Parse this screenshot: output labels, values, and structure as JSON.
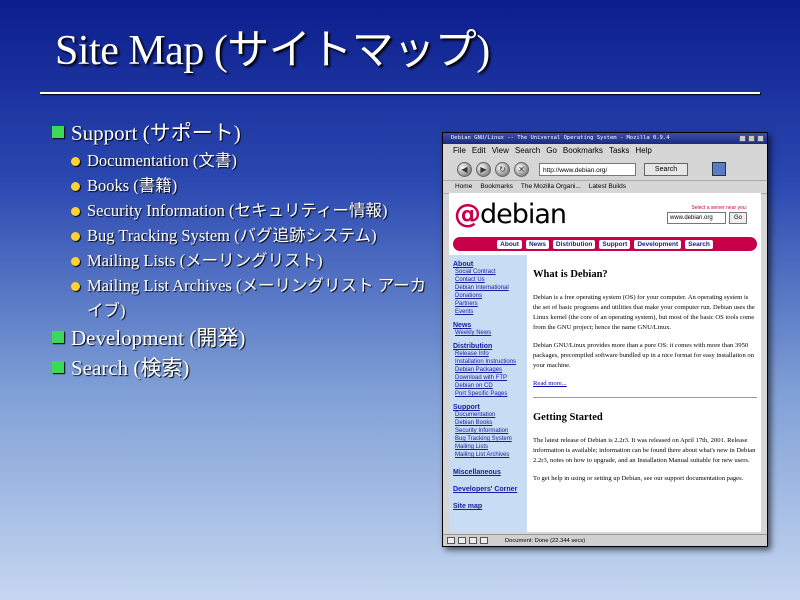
{
  "slide": {
    "title": "Site Map (サイトマップ)",
    "outline": [
      {
        "label": "Support (サポート)",
        "children": [
          "Documentation (文書)",
          "Books (書籍)",
          "Security Information (セキュリティー情報)",
          "Bug Tracking System (バグ追跡システム)",
          "Mailing Lists (メーリングリスト)",
          "Mailing List Archives (メーリングリスト アーカイブ)"
        ]
      },
      {
        "label": "Development (開発)"
      },
      {
        "label": "Search (検索)"
      }
    ]
  },
  "browser": {
    "window_title": "Debian GNU/Linux -- The Universal Operating System - Mozilla 0.9.4",
    "menu": [
      "File",
      "Edit",
      "View",
      "Search",
      "Go",
      "Bookmarks",
      "Tasks",
      "Help"
    ],
    "url": "http://www.debian.org/",
    "search_button": "Search",
    "personal_toolbar": [
      "Home",
      "Bookmarks",
      "The Mozilla Organi...",
      "Latest Builds"
    ],
    "status": "Document: Done (22.344 secs)"
  },
  "page": {
    "logo_text": "debian",
    "mirror_label": "Select a server near you:",
    "mirror_value": "www.debian.org",
    "go_label": "Go",
    "nav": [
      "About",
      "News",
      "Distribution",
      "Support",
      "Development",
      "Search"
    ],
    "sidebar": [
      {
        "title": "About",
        "items": [
          "Social Contract",
          "Contact Us",
          "Debian International",
          "Donations",
          "Partners",
          "Events"
        ]
      },
      {
        "title": "News",
        "items": [
          "Weekly News"
        ]
      },
      {
        "title": "Distribution",
        "items": [
          "Release Info",
          "Installation Instructions",
          "Debian Packages",
          "Download with FTP",
          "Debian on CD",
          "Port Specific Pages"
        ]
      },
      {
        "title": "Support",
        "items": [
          "Documentation",
          "Debian Books",
          "Security Information",
          "Bug Tracking System",
          "Mailing Lists",
          "Mailing List Archives"
        ]
      },
      {
        "title": "Miscellaneous",
        "items": []
      },
      {
        "title": "Developers' Corner",
        "items": []
      },
      {
        "title": "Site map",
        "items": []
      }
    ],
    "h1": "What is Debian?",
    "p1": "Debian is a free operating system (OS) for your computer. An operating system is the set of basic programs and utilities that make your computer run. Debian uses the Linux kernel (the core of an operating system), but most of the basic OS tools come from the GNU project; hence the name GNU/Linux.",
    "p2": "Debian GNU/Linux provides more than a pure OS: it comes with more than 3950 packages, precompiled software bundled up in a nice format for easy installation on your machine.",
    "read_more": "Read more...",
    "h2": "Getting Started",
    "p3": "The latest release of Debian is 2.2r3. It was released on April 17th, 2001. Release information is available; information can be found there about what's new in Debian 2.2r3, notes on how to upgrade, and an Installation Manual suitable for new users.",
    "p4": "To get help in using or setting up Debian, see our support documentation pages."
  }
}
